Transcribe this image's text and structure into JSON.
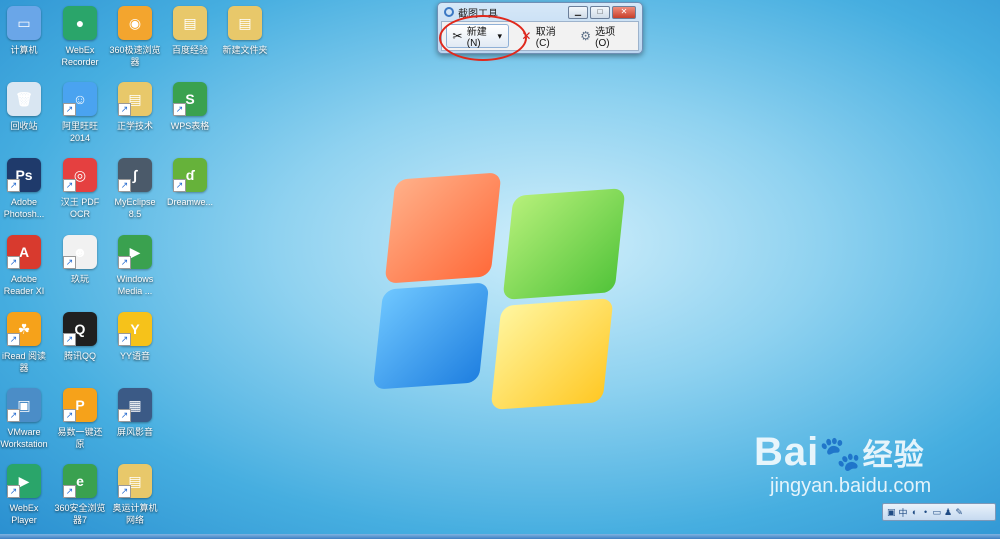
{
  "desktop_icons": [
    {
      "label": "计算机",
      "name": "computer-icon",
      "color": "#6aa6e8",
      "glyph": "▭",
      "shortcut": false
    },
    {
      "label": "WebEx\nRecorder",
      "name": "webex-recorder-icon",
      "color": "#2aa56a",
      "glyph": "●",
      "shortcut": false
    },
    {
      "label": "360极速浏览\n器",
      "name": "360-browser-icon",
      "color": "#f3a52e",
      "glyph": "◉",
      "shortcut": false
    },
    {
      "label": "百度经验",
      "name": "folder-baidu-icon",
      "color": "#e8c86a",
      "glyph": "▤",
      "shortcut": false
    },
    {
      "label": "新建文件夹",
      "name": "folder-new-icon",
      "color": "#e8c86a",
      "glyph": "▤",
      "shortcut": false
    },
    {
      "label": "回收站",
      "name": "recycle-bin-icon",
      "color": "#d9e6f2",
      "glyph": "🗑",
      "shortcut": false
    },
    {
      "label": "阿里旺旺\n2014",
      "name": "aliwangwang-icon",
      "color": "#4aa3f0",
      "glyph": "☺",
      "shortcut": true
    },
    {
      "label": "正学技术",
      "name": "folder-zhengxue-icon",
      "color": "#e8c86a",
      "glyph": "▤",
      "shortcut": true
    },
    {
      "label": "WPS表格",
      "name": "wps-spreadsheet-icon",
      "color": "#3aa14f",
      "glyph": "S",
      "shortcut": true
    },
    {
      "label": "Adobe\nPhotosh...",
      "name": "photoshop-icon",
      "color": "#1f3a6b",
      "glyph": "Ps",
      "shortcut": true
    },
    {
      "label": "汉王 PDF\nOCR",
      "name": "hanwang-pdf-ocr-icon",
      "color": "#e54040",
      "glyph": "◎",
      "shortcut": true
    },
    {
      "label": "MyEclipse\n8.5",
      "name": "myeclipse-icon",
      "color": "#4b5a6a",
      "glyph": "∫",
      "shortcut": true
    },
    {
      "label": "Dreamwe...",
      "name": "dreamweaver-icon",
      "color": "#66b23a",
      "glyph": "ɗ",
      "shortcut": true
    },
    {
      "label": "Adobe\nReader XI",
      "name": "adobe-reader-icon",
      "color": "#d83a2e",
      "glyph": "A",
      "shortcut": true
    },
    {
      "label": "玖玩",
      "name": "jiuwan-icon",
      "color": "#f1f1f1",
      "glyph": "☻",
      "shortcut": true
    },
    {
      "label": "Windows\nMedia ...",
      "name": "windows-media-icon",
      "color": "#3aa14f",
      "glyph": "▶",
      "shortcut": true
    },
    {
      "label": "iRead 阅读\n器",
      "name": "iread-icon",
      "color": "#f6a21a",
      "glyph": "☘",
      "shortcut": true
    },
    {
      "label": "腾讯QQ",
      "name": "qq-icon",
      "color": "#202020",
      "glyph": "Q",
      "shortcut": true
    },
    {
      "label": "YY语音",
      "name": "yy-voice-icon",
      "color": "#f6c21a",
      "glyph": "Y",
      "shortcut": true
    },
    {
      "label": "VMware\nWorkstation",
      "name": "vmware-icon",
      "color": "#4b8dc7",
      "glyph": "▣",
      "shortcut": true
    },
    {
      "label": "易数一键还\n原",
      "name": "yishu-restore-icon",
      "color": "#f6a21a",
      "glyph": "P",
      "shortcut": true
    },
    {
      "label": "屏风影音",
      "name": "video-player-icon",
      "color": "#3b5a86",
      "glyph": "▦",
      "shortcut": true
    },
    {
      "label": "WebEx\nPlayer",
      "name": "webex-player-icon",
      "color": "#2aa56a",
      "glyph": "▶",
      "shortcut": true
    },
    {
      "label": "360安全浏览\n器7",
      "name": "360-safe-browser-icon",
      "color": "#3aa14f",
      "glyph": "e",
      "shortcut": true
    },
    {
      "label": "奥运计算机\n网络",
      "name": "folder-network-icon",
      "color": "#e8c86a",
      "glyph": "▤",
      "shortcut": true
    }
  ],
  "tool_window": {
    "title": "截图工具",
    "buttons": {
      "new": "新建(N)",
      "cancel": "取消(C)",
      "options": "选项(O)"
    }
  },
  "watermark": {
    "brand": "Bai",
    "brand_suffix": "经验",
    "url": "jingyan.baidu.com"
  },
  "tray_items": [
    "中",
    "◐",
    "•",
    "▭",
    "♟",
    "✎"
  ]
}
